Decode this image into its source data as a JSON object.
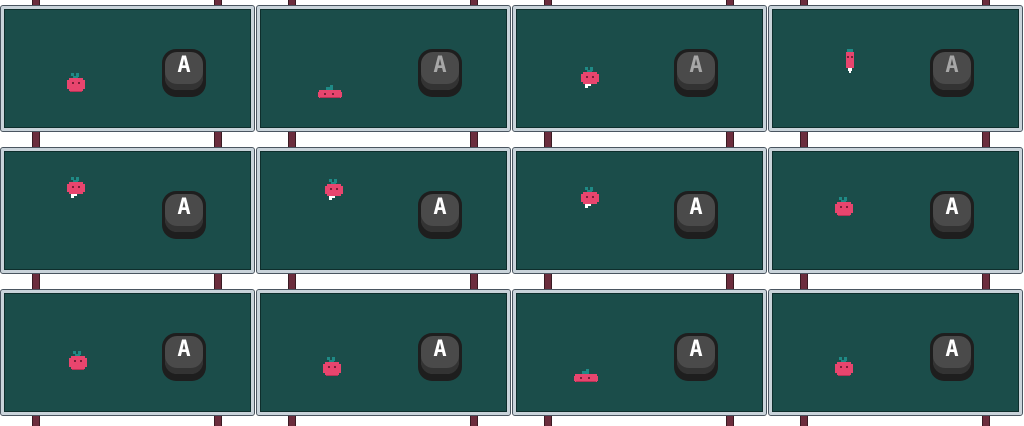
{
  "sprite_sheet": {
    "columns": 4,
    "rows": 3,
    "button_label": "A",
    "colors": {
      "background": "#ffffff",
      "panel": "#1b4d4a",
      "panel_border": "#c9d3da",
      "post": "#6b2d3d",
      "button_face": "#4a4a4a",
      "button_rim": "#1e1e1e",
      "letter_normal": "#ffffff",
      "letter_dim": "#a7a7a7",
      "radish_body": "#e8456e",
      "radish_leaf": "#1f8a86"
    },
    "frames": [
      {
        "pose": "idle",
        "button": "normal"
      },
      {
        "pose": "squash",
        "button": "dim"
      },
      {
        "pose": "hop",
        "button": "dim"
      },
      {
        "pose": "stretch",
        "button": "dim"
      },
      {
        "pose": "hop",
        "button": "normal"
      },
      {
        "pose": "hop",
        "button": "normal"
      },
      {
        "pose": "hop",
        "button": "normal"
      },
      {
        "pose": "idle",
        "button": "normal"
      },
      {
        "pose": "idle",
        "button": "normal"
      },
      {
        "pose": "idle",
        "button": "normal"
      },
      {
        "pose": "squash",
        "button": "normal"
      },
      {
        "pose": "idle",
        "button": "normal"
      }
    ]
  }
}
